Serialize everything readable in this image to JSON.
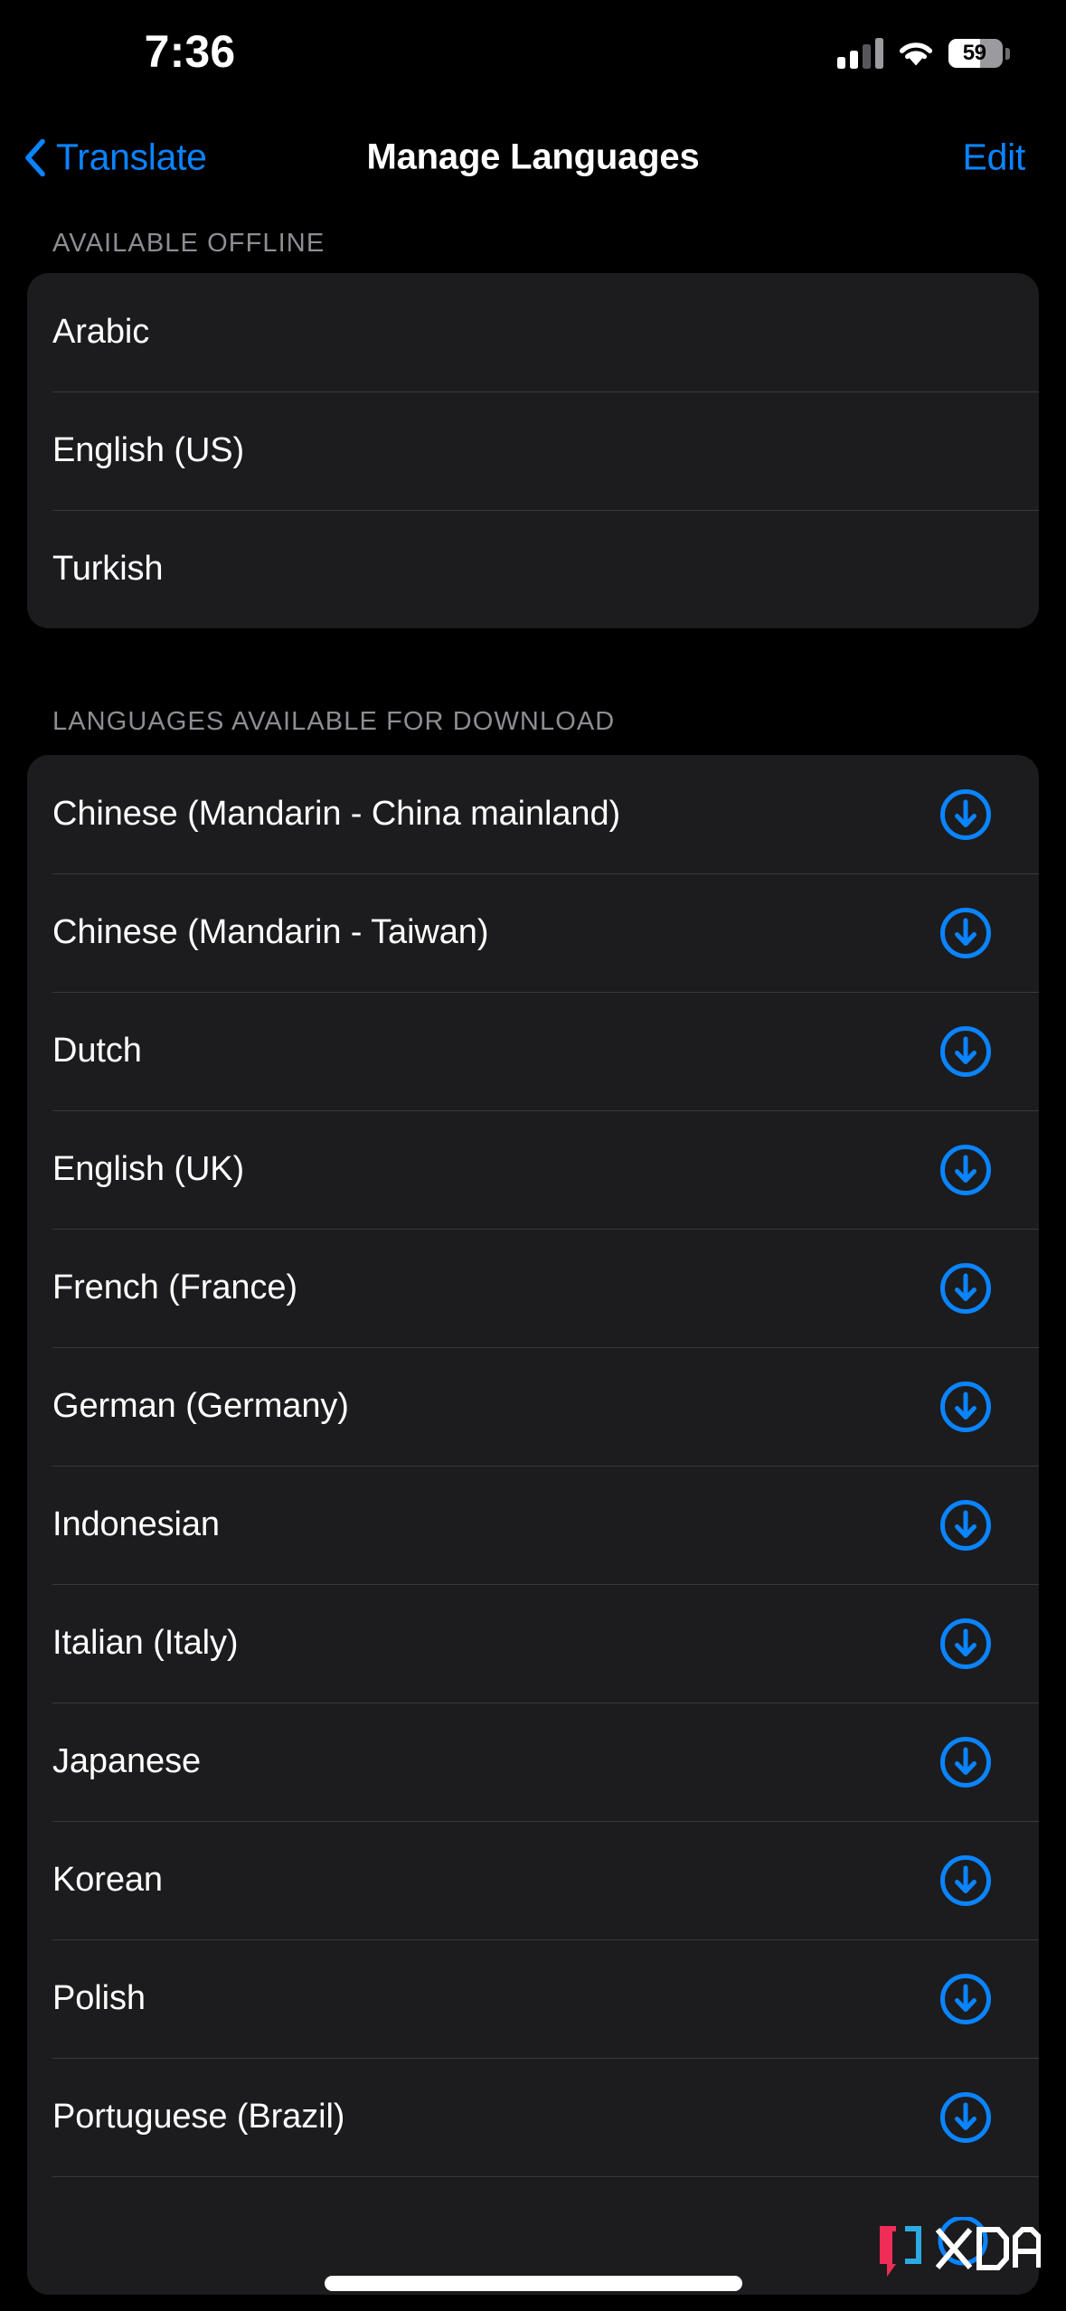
{
  "status_bar": {
    "time": "7:36",
    "battery_percent": "59",
    "battery_level": 59,
    "signal_icon": "cellular-signal-icon",
    "wifi_icon": "wifi-icon"
  },
  "nav_bar": {
    "back_label": "Translate",
    "back_icon": "chevron-left-icon",
    "title": "Manage Languages",
    "edit_label": "Edit"
  },
  "colors": {
    "accent_blue": "#0a84ff",
    "background": "#000000",
    "card": "#1c1c1e",
    "separator": "#39393c",
    "header_text": "#8d8d93",
    "primary_text": "#ffffff"
  },
  "sections": [
    {
      "header": "AVAILABLE OFFLINE",
      "rows": [
        {
          "label": "Arabic",
          "has_download": false
        },
        {
          "label": "English (US)",
          "has_download": false
        },
        {
          "label": "Turkish",
          "has_download": false
        }
      ]
    },
    {
      "header": "LANGUAGES AVAILABLE FOR DOWNLOAD",
      "rows": [
        {
          "label": "Chinese (Mandarin - China mainland)",
          "has_download": true
        },
        {
          "label": "Chinese (Mandarin - Taiwan)",
          "has_download": true
        },
        {
          "label": "Dutch",
          "has_download": true
        },
        {
          "label": "English (UK)",
          "has_download": true
        },
        {
          "label": "French (France)",
          "has_download": true
        },
        {
          "label": "German (Germany)",
          "has_download": true
        },
        {
          "label": "Indonesian",
          "has_download": true
        },
        {
          "label": "Italian (Italy)",
          "has_download": true
        },
        {
          "label": "Japanese",
          "has_download": true
        },
        {
          "label": "Korean",
          "has_download": true
        },
        {
          "label": "Polish",
          "has_download": true
        },
        {
          "label": "Portuguese (Brazil)",
          "has_download": true
        }
      ]
    }
  ],
  "watermark": {
    "text": "XDA"
  },
  "icons": {
    "download": "download-circle-icon"
  }
}
